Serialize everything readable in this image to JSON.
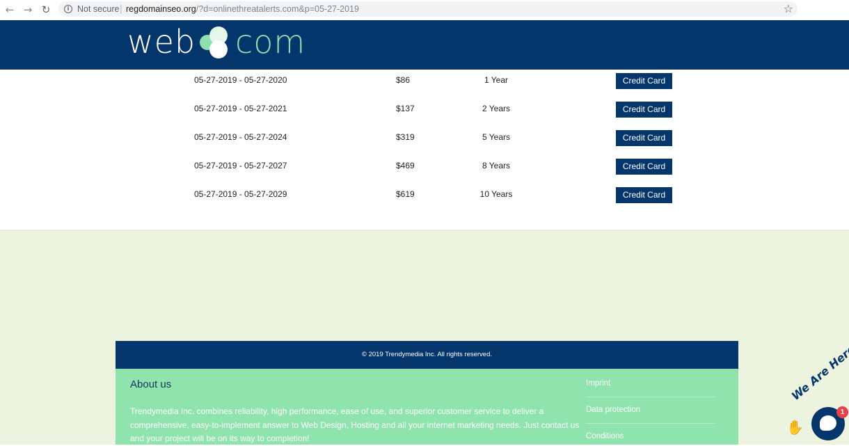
{
  "browser": {
    "not_secure_label": "Not secure",
    "url_host": "regdomainseo.org",
    "url_rest": "/?d=onlinethreatalerts.com&p=05-27-2019"
  },
  "header": {
    "logo_left": "web",
    "logo_right": "com",
    "logo_colors": {
      "dark": "#04366c",
      "white": "#ffffff",
      "green": "#8fdfb0"
    }
  },
  "pricing": {
    "rows": [
      {
        "dates": "05-27-2019 - 05-27-2020",
        "price": "$86",
        "term": "1 Year",
        "button": "Credit Card"
      },
      {
        "dates": "05-27-2019 - 05-27-2021",
        "price": "$137",
        "term": "2 Years",
        "button": "Credit Card"
      },
      {
        "dates": "05-27-2019 - 05-27-2024",
        "price": "$319",
        "term": "5 Years",
        "button": "Credit Card"
      },
      {
        "dates": "05-27-2019 - 05-27-2027",
        "price": "$469",
        "term": "8 Years",
        "button": "Credit Card"
      },
      {
        "dates": "05-27-2019 - 05-27-2029",
        "price": "$619",
        "term": "10 Years",
        "button": "Credit Card"
      }
    ]
  },
  "footer": {
    "copyright": "© 2019 Trendymedia Inc. All rights reserved.",
    "about_title": "About us",
    "about_text": "Trendymedia Inc. combines reliability, high performance, ease of use, and superior customer service to deliver a comprehensive, easy-to-implement answer to Web Design, Hosting and all your internet marketing needs. Just contact us and your project will be on its way to completion!",
    "links": [
      "Imprint",
      "Data protection",
      "Conditions"
    ]
  },
  "chat": {
    "badge_text": "We Are Here!",
    "unread_count": "1"
  },
  "icons": {
    "back": "arrow-left-icon",
    "forward": "arrow-right-icon",
    "reload": "reload-icon",
    "info": "info-icon",
    "bookmark": "star-icon",
    "chat": "chat-bubble-icon",
    "wave": "waving-hand-icon"
  },
  "colors": {
    "brand_navy": "#04366c",
    "footer_green": "#8fe3ad",
    "page_tint": "#ecf3df",
    "badge_red": "#e8404a"
  }
}
